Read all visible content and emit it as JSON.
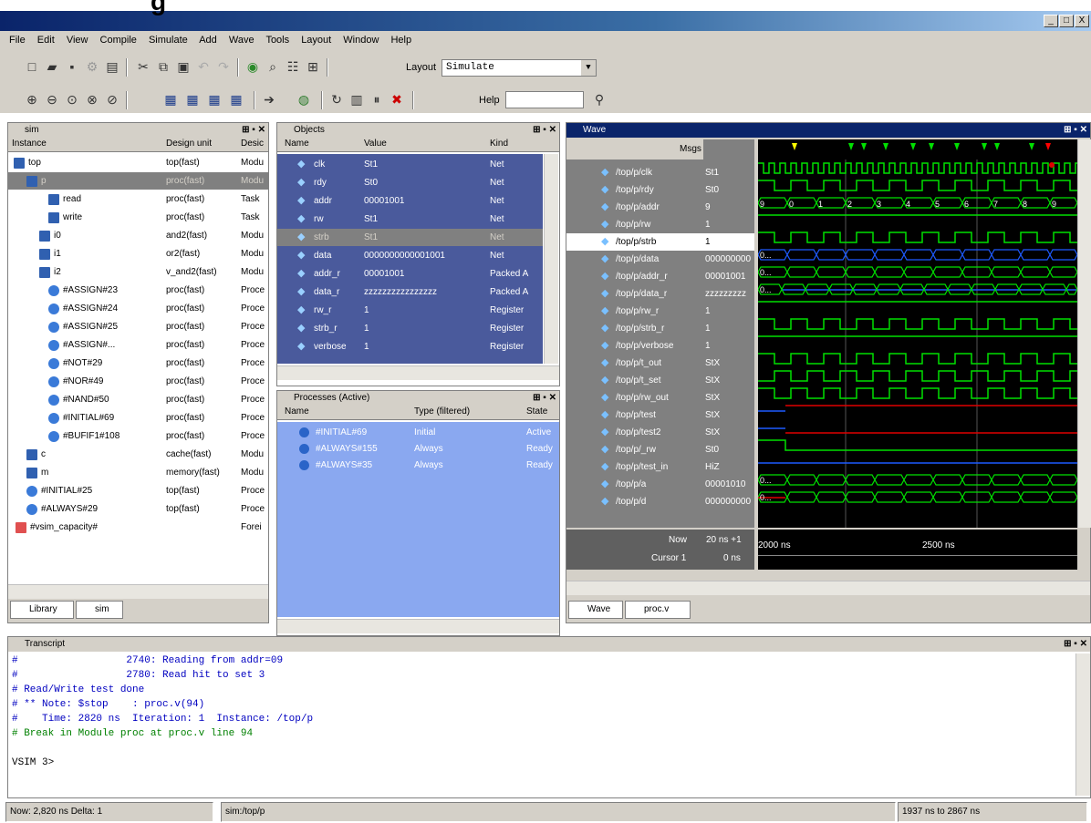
{
  "title_fragment": "g",
  "window_buttons": [
    "_",
    "□",
    "X"
  ],
  "menu": [
    "File",
    "Edit",
    "View",
    "Compile",
    "Simulate",
    "Add",
    "Wave",
    "Tools",
    "Layout",
    "Window",
    "Help"
  ],
  "toolbar": {
    "layout_label": "Layout",
    "layout_value": "Simulate",
    "help_label": "Help",
    "help_value": ""
  },
  "sim_panel": {
    "title": "sim",
    "headers": [
      "Instance",
      "Design unit",
      "Desic"
    ],
    "rows": [
      {
        "name": "top",
        "unit": "top(fast)",
        "kind": "Modu"
      },
      {
        "name": "p",
        "unit": "proc(fast)",
        "kind": "Modu"
      },
      {
        "name": "read",
        "unit": "proc(fast)",
        "kind": "Task"
      },
      {
        "name": "write",
        "unit": "proc(fast)",
        "kind": "Task"
      },
      {
        "name": "i0",
        "unit": "and2(fast)",
        "kind": "Modu"
      },
      {
        "name": "i1",
        "unit": "or2(fast)",
        "kind": "Modu"
      },
      {
        "name": "i2",
        "unit": "v_and2(fast)",
        "kind": "Modu"
      },
      {
        "name": "#ASSIGN#23",
        "unit": "proc(fast)",
        "kind": "Proce"
      },
      {
        "name": "#ASSIGN#24",
        "unit": "proc(fast)",
        "kind": "Proce"
      },
      {
        "name": "#ASSIGN#25",
        "unit": "proc(fast)",
        "kind": "Proce"
      },
      {
        "name": "#ASSIGN#...",
        "unit": "proc(fast)",
        "kind": "Proce"
      },
      {
        "name": "#NOT#29",
        "unit": "proc(fast)",
        "kind": "Proce"
      },
      {
        "name": "#NOR#49",
        "unit": "proc(fast)",
        "kind": "Proce"
      },
      {
        "name": "#NAND#50",
        "unit": "proc(fast)",
        "kind": "Proce"
      },
      {
        "name": "#INITIAL#69",
        "unit": "proc(fast)",
        "kind": "Proce"
      },
      {
        "name": "#BUFIF1#108",
        "unit": "proc(fast)",
        "kind": "Proce"
      },
      {
        "name": "c",
        "unit": "cache(fast)",
        "kind": "Modu"
      },
      {
        "name": "m",
        "unit": "memory(fast)",
        "kind": "Modu"
      },
      {
        "name": "#INITIAL#25",
        "unit": "top(fast)",
        "kind": "Proce"
      },
      {
        "name": "#ALWAYS#29",
        "unit": "top(fast)",
        "kind": "Proce"
      },
      {
        "name": "#vsim_capacity#",
        "unit": "",
        "kind": "Forei"
      }
    ],
    "tabs": [
      "Library",
      "sim"
    ]
  },
  "objects_panel": {
    "title": "Objects",
    "headers": [
      "Name",
      "Value",
      "Kind"
    ],
    "rows": [
      {
        "name": "clk",
        "value": "St1",
        "kind": "Net"
      },
      {
        "name": "rdy",
        "value": "St0",
        "kind": "Net"
      },
      {
        "name": "addr",
        "value": "00001001",
        "kind": "Net"
      },
      {
        "name": "rw",
        "value": "St1",
        "kind": "Net"
      },
      {
        "name": "strb",
        "value": "St1",
        "kind": "Net"
      },
      {
        "name": "data",
        "value": "0000000000001001",
        "kind": "Net"
      },
      {
        "name": "addr_r",
        "value": "00001001",
        "kind": "Packed A"
      },
      {
        "name": "data_r",
        "value": "zzzzzzzzzzzzzzzz",
        "kind": "Packed A"
      },
      {
        "name": "rw_r",
        "value": "1",
        "kind": "Register"
      },
      {
        "name": "strb_r",
        "value": "1",
        "kind": "Register"
      },
      {
        "name": "verbose",
        "value": "1",
        "kind": "Register"
      }
    ]
  },
  "processes_panel": {
    "title": "Processes (Active)",
    "headers": [
      "Name",
      "Type (filtered)",
      "State"
    ],
    "rows": [
      {
        "name": "#INITIAL#69",
        "type": "Initial",
        "state": "Active"
      },
      {
        "name": "#ALWAYS#155",
        "type": "Always",
        "state": "Ready"
      },
      {
        "name": "#ALWAYS#35",
        "type": "Always",
        "state": "Ready"
      }
    ]
  },
  "wave_panel": {
    "title": "Wave",
    "msgs_label": "Msgs",
    "signals": [
      {
        "name": "/top/p/clk",
        "value": "St1"
      },
      {
        "name": "/top/p/rdy",
        "value": "St0"
      },
      {
        "name": "/top/p/addr",
        "value": "9"
      },
      {
        "name": "/top/p/rw",
        "value": "1"
      },
      {
        "name": "/top/p/strb",
        "value": "1"
      },
      {
        "name": "/top/p/data",
        "value": "000000000"
      },
      {
        "name": "/top/p/addr_r",
        "value": "00001001"
      },
      {
        "name": "/top/p/data_r",
        "value": "zzzzzzzzz"
      },
      {
        "name": "/top/p/rw_r",
        "value": "1"
      },
      {
        "name": "/top/p/strb_r",
        "value": "1"
      },
      {
        "name": "/top/p/verbose",
        "value": "1"
      },
      {
        "name": "/top/p/t_out",
        "value": "StX"
      },
      {
        "name": "/top/p/t_set",
        "value": "StX"
      },
      {
        "name": "/top/p/rw_out",
        "value": "StX"
      },
      {
        "name": "/top/p/test",
        "value": "StX"
      },
      {
        "name": "/top/p/test2",
        "value": "StX"
      },
      {
        "name": "/top/p/_rw",
        "value": "St0"
      },
      {
        "name": "/top/p/test_in",
        "value": "HiZ"
      },
      {
        "name": "/top/p/a",
        "value": "00001010"
      },
      {
        "name": "/top/p/d",
        "value": "000000000"
      }
    ],
    "addr_labels": [
      "9",
      "0",
      "1",
      "2",
      "3",
      "4",
      "5",
      "6",
      "7",
      "8",
      "9"
    ],
    "bus_label": "0...",
    "now_label": "Now",
    "now_value": "20 ns +1",
    "cursor_label": "Cursor 1",
    "cursor_value": "0 ns",
    "ruler": [
      "2000 ns",
      "2500 ns"
    ],
    "tabs": [
      "Wave",
      "proc.v"
    ]
  },
  "transcript": {
    "title": "Transcript",
    "lines": [
      "#                  2740: Reading from addr=09",
      "#                  2780: Read hit to set 3",
      "# Read/Write test done",
      "# ** Note: $stop    : proc.v(94)",
      "#    Time: 2820 ns  Iteration: 1  Instance: /top/p",
      "# Break in Module proc at proc.v line 94",
      "",
      "VSIM 3>"
    ]
  },
  "status": {
    "now": "Now: 2,820 ns  Delta: 1",
    "path": "sim:/top/p",
    "range": "1937 ns to 2867 ns"
  },
  "colors": {
    "wave_green": "#00e000",
    "wave_red": "#e00000",
    "wave_blue": "#1e5aff",
    "objects_bg": "#4a5a9c",
    "process_bg": "#8aa8f0"
  }
}
